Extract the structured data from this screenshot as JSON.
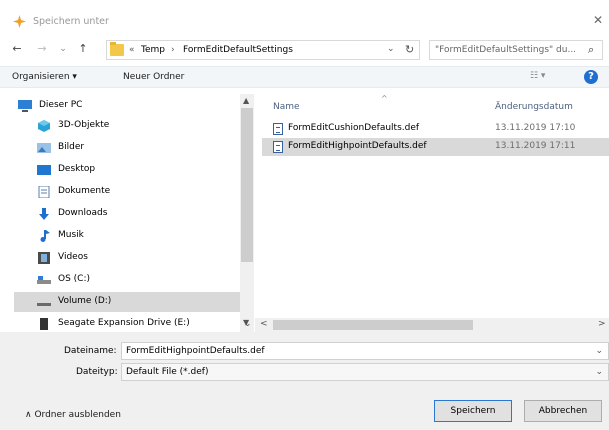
{
  "window": {
    "title": "Speichern unter",
    "close_symbol": "✕",
    "title_icon": "star-app-icon"
  },
  "nav": {
    "back": "←",
    "forward": "→",
    "recent": "⌄",
    "up": "↑",
    "breadcrumb_prefix": "«",
    "crumbs": [
      "Temp",
      "FormEditDefaultSettings"
    ],
    "separator": "›",
    "address_dropdown": "⌄",
    "refresh": "↻",
    "search_placeholder": "\"FormEditDefaultSettings\" du...",
    "search_icon": "⌕"
  },
  "toolbar": {
    "organize": "Organisieren ▾",
    "new_folder": "Neuer Ordner",
    "view_symbol": "☷ ▾",
    "help": "?"
  },
  "tree": {
    "items": [
      {
        "label": "Dieser PC",
        "icon": "pc-icon"
      },
      {
        "label": "3D-Objekte",
        "icon": "cube-icon"
      },
      {
        "label": "Bilder",
        "icon": "pictures-icon"
      },
      {
        "label": "Desktop",
        "icon": "desktop-icon"
      },
      {
        "label": "Dokumente",
        "icon": "documents-icon"
      },
      {
        "label": "Downloads",
        "icon": "downloads-icon"
      },
      {
        "label": "Musik",
        "icon": "music-icon"
      },
      {
        "label": "Videos",
        "icon": "videos-icon"
      },
      {
        "label": "OS (C:)",
        "icon": "drive-icon"
      },
      {
        "label": "Volume (D:)",
        "icon": "drive-icon"
      },
      {
        "label": "Seagate Expansion Drive (E:)",
        "icon": "external-drive-icon"
      }
    ],
    "selected_index": 9
  },
  "list": {
    "columns": {
      "name": "Name",
      "date": "Änderungsdatum",
      "sort_caret": "^"
    },
    "rows": [
      {
        "name": "FormEditCushionDefaults.def",
        "date": "13.11.2019 17:10"
      },
      {
        "name": "FormEditHighpointDefaults.def",
        "date": "13.11.2019 17:11"
      }
    ],
    "selected_index": 1
  },
  "scroll": {
    "up": "▲",
    "down": "▼",
    "left": "<",
    "right": ">",
    "corner": "⌄"
  },
  "form": {
    "filename_label": "Dateiname:",
    "filename_value": "FormEditHighpointDefaults.def",
    "filetype_label": "Dateityp:",
    "filetype_value": "Default File (*.def)",
    "dropdown_symbol": "⌄"
  },
  "buttons": {
    "save": "Speichern",
    "cancel": "Abbrechen",
    "hide_folders": "∧  Ordner ausblenden"
  },
  "colors": {
    "accent": "#1f6fd1",
    "selection": "#d9d9d9",
    "header_text": "#4d6082",
    "folder": "#f2c84b"
  }
}
